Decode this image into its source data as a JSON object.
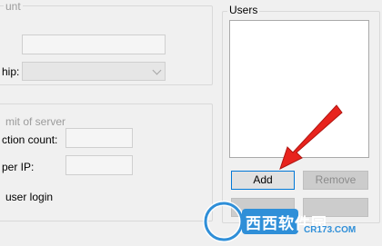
{
  "left_panel": {
    "account_group": {
      "title": "unt",
      "membership_label": "hip:"
    },
    "limit_group": {
      "title": "mit of server",
      "connection_label": "ction count:",
      "per_ip_label": "per IP:",
      "user_login_label": "user login"
    }
  },
  "users_panel": {
    "title": "Users",
    "add_button": "Add",
    "remove_button": "Remove"
  },
  "watermark": {
    "brand": "西西软件园",
    "site": "CR173.COM"
  },
  "colors": {
    "arrow": "#e8231d",
    "focus_border": "#0078d7",
    "watermark_blue": "#2f8fd8"
  }
}
